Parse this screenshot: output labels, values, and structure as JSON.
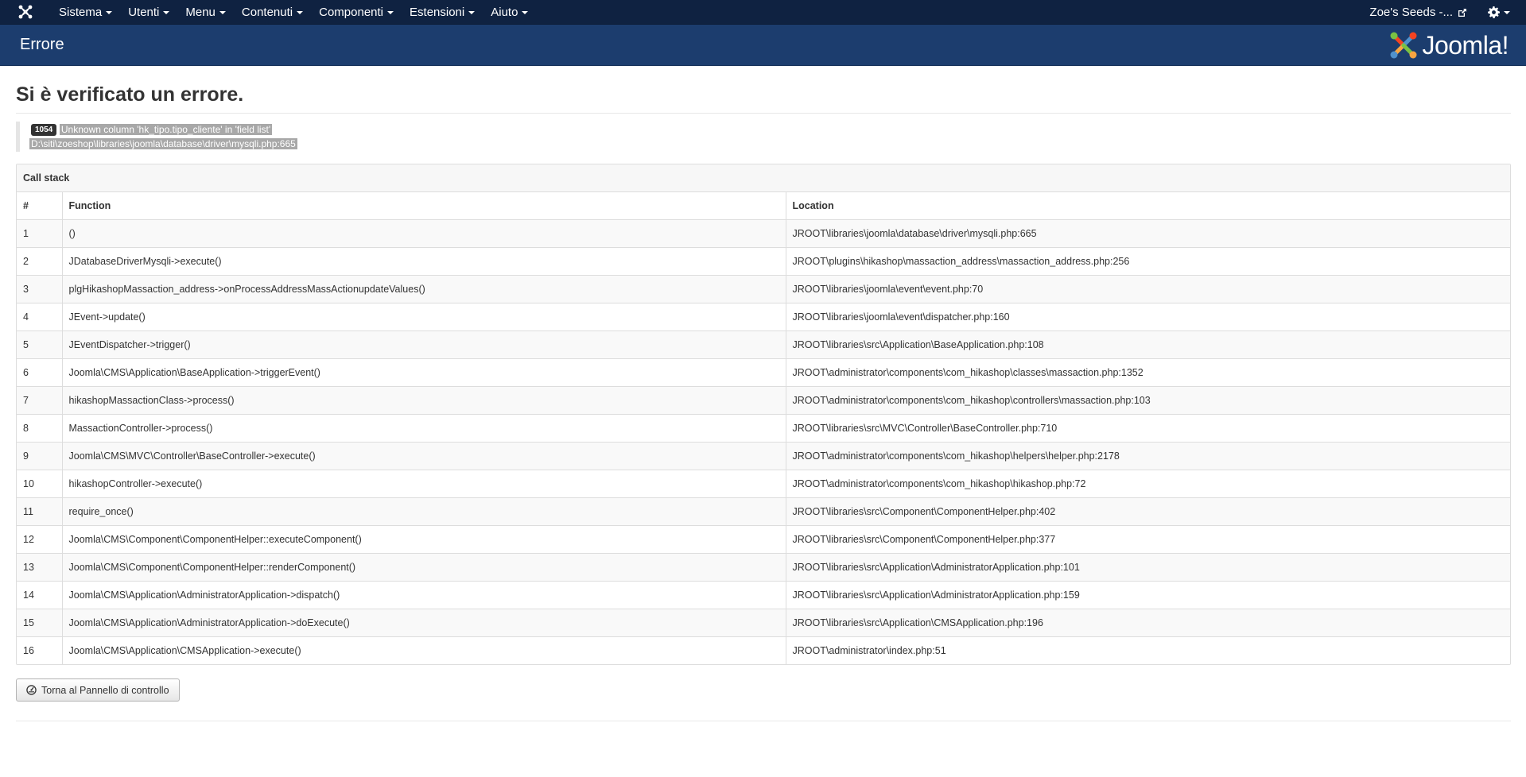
{
  "navbar": {
    "menu": [
      {
        "label": "Sistema"
      },
      {
        "label": "Utenti"
      },
      {
        "label": "Menu"
      },
      {
        "label": "Contenuti"
      },
      {
        "label": "Componenti"
      },
      {
        "label": "Estensioni"
      },
      {
        "label": "Aiuto"
      }
    ],
    "site_name": "Zoe's Seeds -...",
    "icons": {
      "logo": "joomla-icon",
      "external": "external-link-icon",
      "settings": "gear-icon"
    }
  },
  "subhead": {
    "title": "Errore",
    "brand": "Joomla!"
  },
  "error": {
    "heading": "Si è verificato un errore.",
    "code": "1054",
    "message": "Unknown column 'hk_tipo.tipo_cliente' in 'field list'",
    "file": "D:\\siti\\zoeshop\\libraries\\joomla\\database\\driver\\mysqli.php:665"
  },
  "callstack": {
    "caption": "Call stack",
    "columns": [
      "#",
      "Function",
      "Location"
    ],
    "rows": [
      {
        "n": "1",
        "fn": "()",
        "loc": "JROOT\\libraries\\joomla\\database\\driver\\mysqli.php:665"
      },
      {
        "n": "2",
        "fn": "JDatabaseDriverMysqli->execute()",
        "loc": "JROOT\\plugins\\hikashop\\massaction_address\\massaction_address.php:256"
      },
      {
        "n": "3",
        "fn": "plgHikashopMassaction_address->onProcessAddressMassActionupdateValues()",
        "loc": "JROOT\\libraries\\joomla\\event\\event.php:70"
      },
      {
        "n": "4",
        "fn": "JEvent->update()",
        "loc": "JROOT\\libraries\\joomla\\event\\dispatcher.php:160"
      },
      {
        "n": "5",
        "fn": "JEventDispatcher->trigger()",
        "loc": "JROOT\\libraries\\src\\Application\\BaseApplication.php:108"
      },
      {
        "n": "6",
        "fn": "Joomla\\CMS\\Application\\BaseApplication->triggerEvent()",
        "loc": "JROOT\\administrator\\components\\com_hikashop\\classes\\massaction.php:1352"
      },
      {
        "n": "7",
        "fn": "hikashopMassactionClass->process()",
        "loc": "JROOT\\administrator\\components\\com_hikashop\\controllers\\massaction.php:103"
      },
      {
        "n": "8",
        "fn": "MassactionController->process()",
        "loc": "JROOT\\libraries\\src\\MVC\\Controller\\BaseController.php:710"
      },
      {
        "n": "9",
        "fn": "Joomla\\CMS\\MVC\\Controller\\BaseController->execute()",
        "loc": "JROOT\\administrator\\components\\com_hikashop\\helpers\\helper.php:2178"
      },
      {
        "n": "10",
        "fn": "hikashopController->execute()",
        "loc": "JROOT\\administrator\\components\\com_hikashop\\hikashop.php:72"
      },
      {
        "n": "11",
        "fn": "require_once()",
        "loc": "JROOT\\libraries\\src\\Component\\ComponentHelper.php:402"
      },
      {
        "n": "12",
        "fn": "Joomla\\CMS\\Component\\ComponentHelper::executeComponent()",
        "loc": "JROOT\\libraries\\src\\Component\\ComponentHelper.php:377"
      },
      {
        "n": "13",
        "fn": "Joomla\\CMS\\Component\\ComponentHelper::renderComponent()",
        "loc": "JROOT\\libraries\\src\\Application\\AdministratorApplication.php:101"
      },
      {
        "n": "14",
        "fn": "Joomla\\CMS\\Application\\AdministratorApplication->dispatch()",
        "loc": "JROOT\\libraries\\src\\Application\\AdministratorApplication.php:159"
      },
      {
        "n": "15",
        "fn": "Joomla\\CMS\\Application\\AdministratorApplication->doExecute()",
        "loc": "JROOT\\libraries\\src\\Application\\CMSApplication.php:196"
      },
      {
        "n": "16",
        "fn": "Joomla\\CMS\\Application\\CMSApplication->execute()",
        "loc": "JROOT\\administrator\\index.php:51"
      }
    ]
  },
  "back_button": {
    "label": "Torna al Pannello di controllo",
    "icon": "dashboard-icon"
  },
  "colors": {
    "navbar": "#0f2241",
    "subhead": "#1c3d6e",
    "badge": "#333333",
    "selection": "#a8a8a8"
  }
}
